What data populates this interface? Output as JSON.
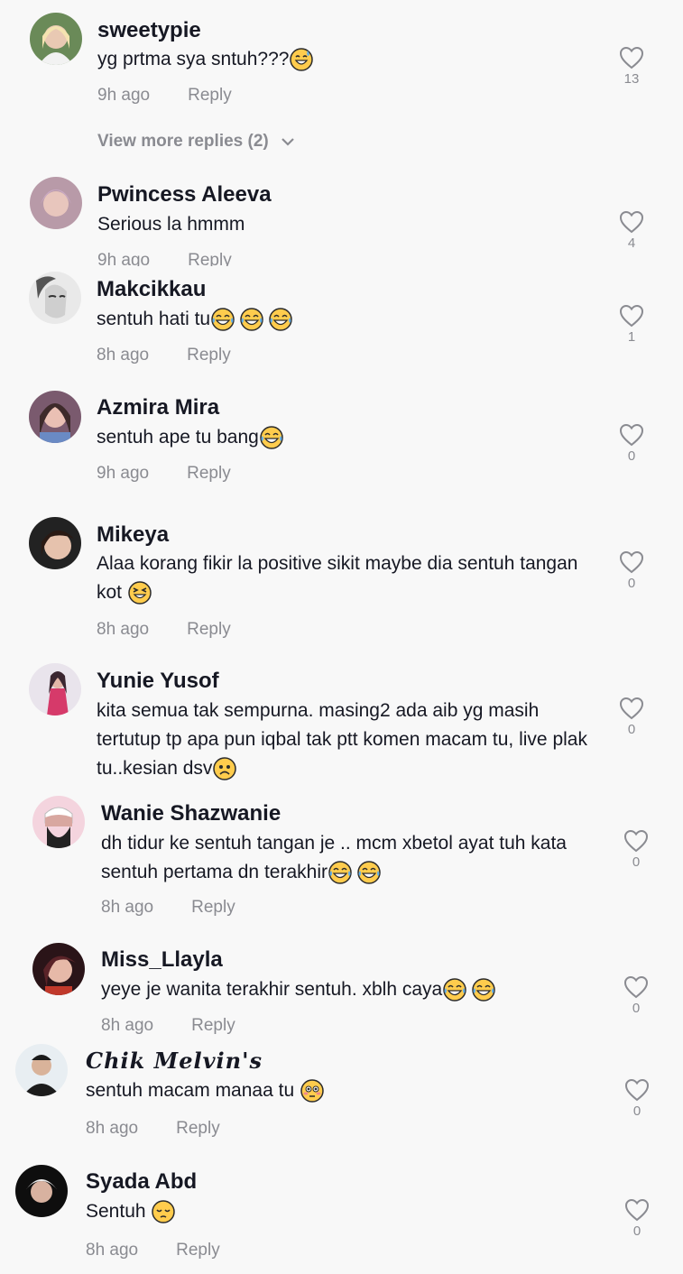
{
  "comments": [
    {
      "username": "sweetypie",
      "text": "yg prtma sya sntuh???",
      "emoji": [
        "sweat"
      ],
      "time": "9h ago",
      "reply": "Reply",
      "likes": "13"
    },
    {
      "username": "Pwincess Aleeva",
      "text": "Serious la hmmm",
      "emoji": [],
      "time": "9h ago",
      "reply": "Reply",
      "likes": "4"
    },
    {
      "username": "Makcikkau",
      "text": "sentuh hati tu",
      "emoji": [
        "laugh",
        "laugh",
        "laugh"
      ],
      "time": "8h ago",
      "reply": "Reply",
      "likes": "1"
    },
    {
      "username": "Azmira Mira",
      "text": "sentuh ape tu bang",
      "emoji": [
        "laugh"
      ],
      "time": "9h ago",
      "reply": "Reply",
      "likes": "0"
    },
    {
      "username": "Mikeya",
      "text": "Alaa korang fikir la positive sikit maybe dia sentuh tangan kot ",
      "emoji": [
        "squint"
      ],
      "time": "8h ago",
      "reply": "Reply",
      "likes": "0"
    },
    {
      "username": "Yunie Yusof",
      "text": "kita semua tak sempurna. masing2 ada aib yg masih tertutup tp apa pun iqbal tak ptt komen macam tu, live plak tu..kesian dsv",
      "emoji": [
        "sad"
      ],
      "time": "8h ago",
      "reply": "Reply",
      "likes": "0"
    },
    {
      "username": "Wanie Shazwanie",
      "text": "dh tidur ke sentuh tangan je .. mcm xbetol ayat tuh kata sentuh pertama dn terakhir",
      "emoji": [
        "laugh",
        "laugh"
      ],
      "time": "8h ago",
      "reply": "Reply",
      "likes": "0"
    },
    {
      "username": "Miss_Llayla",
      "text": "yeye je wanita terakhir sentuh. xblh caya",
      "emoji": [
        "laugh",
        "laugh"
      ],
      "time": "8h ago",
      "reply": "Reply",
      "likes": "0"
    },
    {
      "username": "Chik Melvin's",
      "text": "sentuh macam manaa tu ",
      "emoji": [
        "flushed"
      ],
      "time": "8h ago",
      "reply": "Reply",
      "likes": "0"
    },
    {
      "username": "Syada Abd",
      "text": "Sentuh ",
      "emoji": [
        "pensive"
      ],
      "time": "8h ago",
      "reply": "Reply",
      "likes": "0"
    }
  ],
  "view_more": "View more replies (2)",
  "colors": {
    "text": "#161823",
    "muted": "#8a8b91",
    "background": "#f8f8f8",
    "emoji_yellow": "#ffcc4d"
  },
  "icons": {
    "like": "heart-outline-icon",
    "expand": "chevron-down-icon"
  }
}
